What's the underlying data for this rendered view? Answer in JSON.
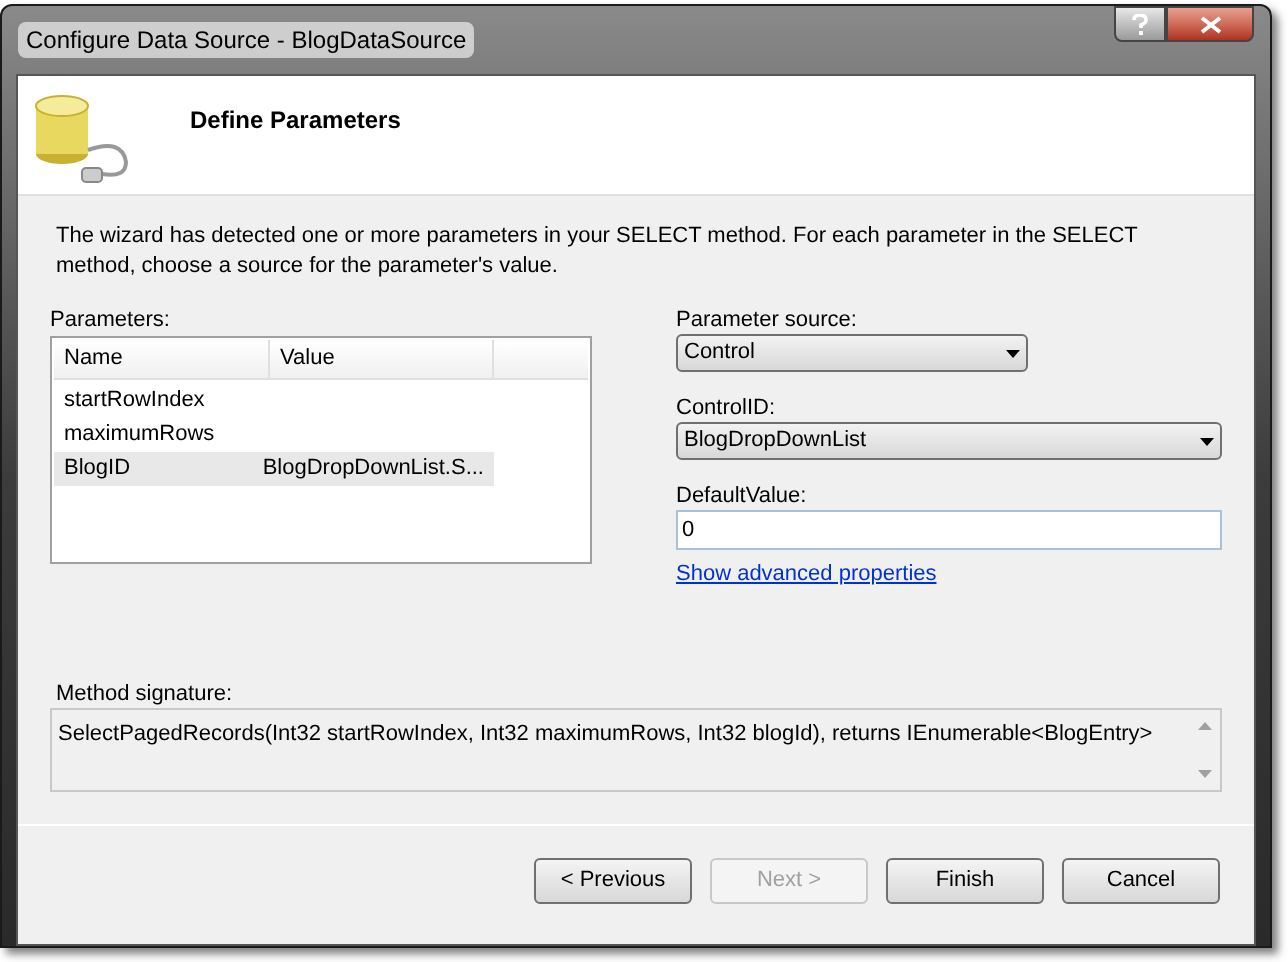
{
  "window": {
    "title": "Configure Data Source - BlogDataSource"
  },
  "header": {
    "title": "Define Parameters"
  },
  "description": "The wizard has detected one or more parameters in your SELECT method. For each parameter in the SELECT method, choose a source for the parameter's value.",
  "parameters": {
    "label": "Parameters:",
    "columns": [
      "Name",
      "Value"
    ],
    "rows": [
      {
        "name": "startRowIndex",
        "value": "",
        "selected": false
      },
      {
        "name": "maximumRows",
        "value": "",
        "selected": false
      },
      {
        "name": "BlogID",
        "value": "BlogDropDownList.S...",
        "selected": true
      }
    ]
  },
  "parameter_source": {
    "label": "Parameter source:",
    "value": "Control"
  },
  "control_id": {
    "label": "ControlID:",
    "value": "BlogDropDownList"
  },
  "default_value": {
    "label": "DefaultValue:",
    "value": "0"
  },
  "advanced_link": "Show advanced properties",
  "method_signature": {
    "label": "Method signature:",
    "text": "SelectPagedRecords(Int32 startRowIndex, Int32 maximumRows, Int32 blogId), returns IEnumerable<BlogEntry>"
  },
  "buttons": [
    {
      "label": "< Previous",
      "disabled": false
    },
    {
      "label": "Next >",
      "disabled": true
    },
    {
      "label": "Finish",
      "disabled": false
    },
    {
      "label": "Cancel",
      "disabled": false
    }
  ]
}
